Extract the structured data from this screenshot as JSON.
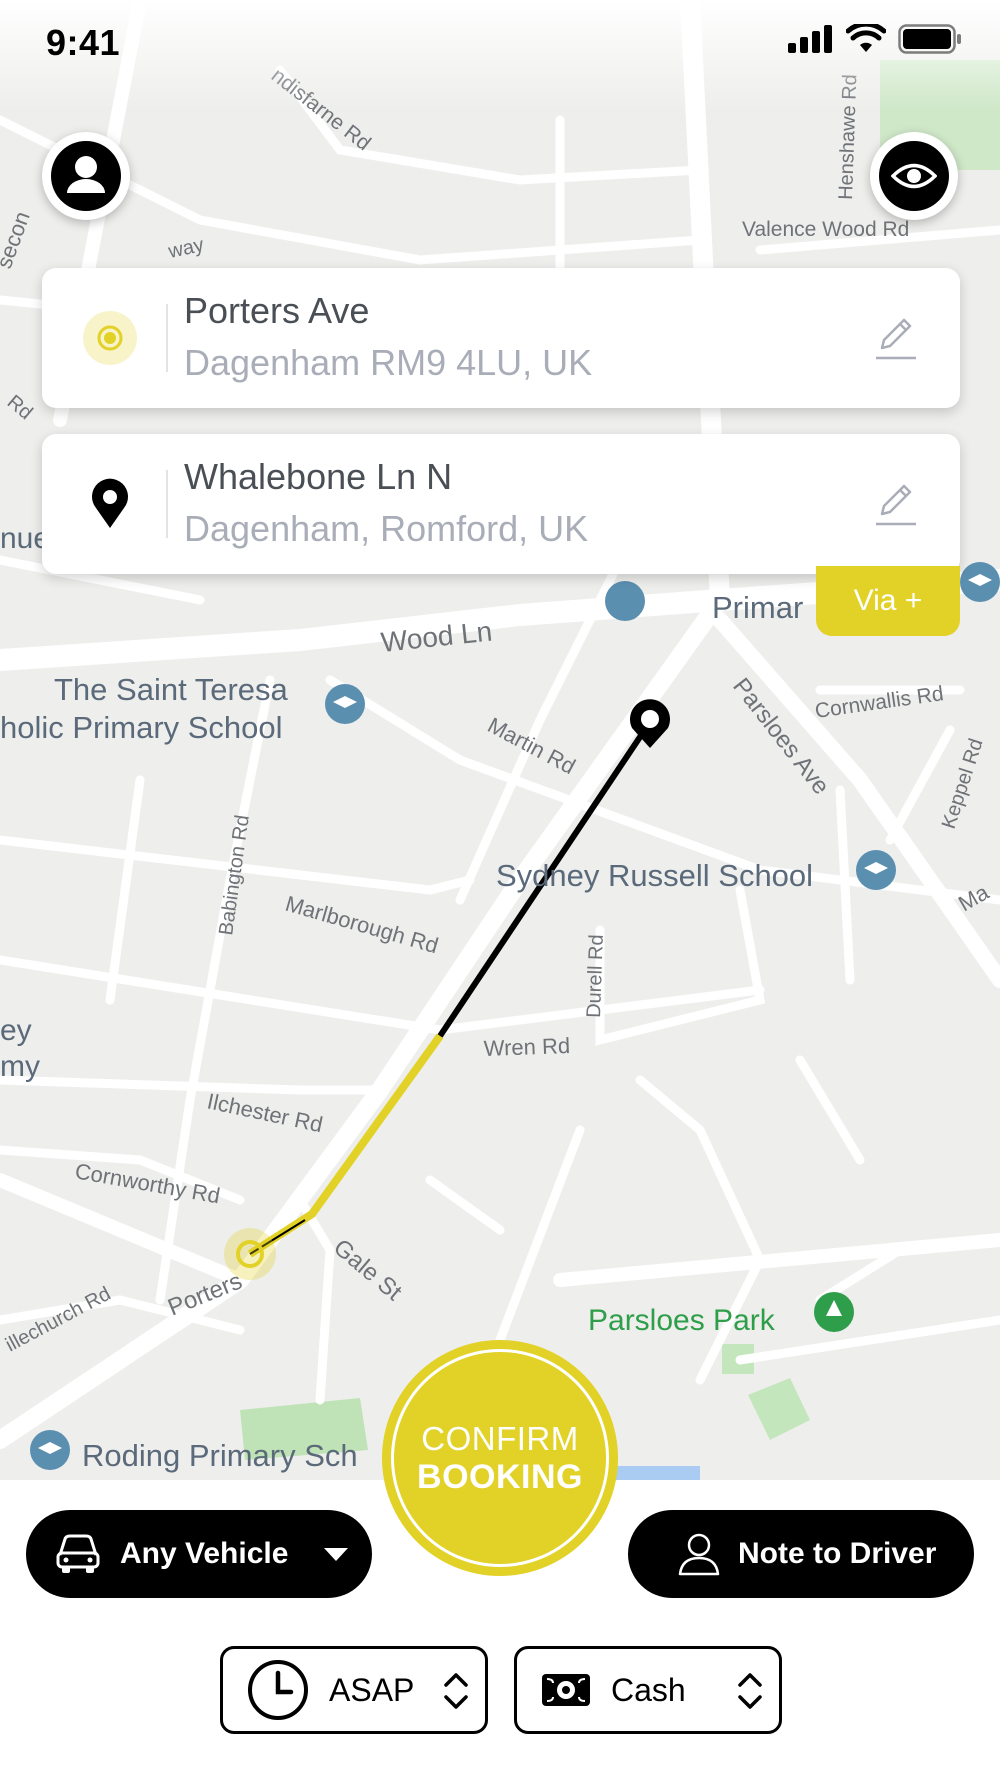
{
  "status_bar": {
    "time": "9:41"
  },
  "colors": {
    "accent": "#e2d126",
    "map_bg": "#eeeeec",
    "road": "#ffffff",
    "school_blue": "#5b8fb0",
    "park_green": "#2e9e4a"
  },
  "icons": {
    "profile": "person-circle-icon",
    "visibility": "eye-icon",
    "pickup": "target-dot-icon",
    "dropoff": "map-pin-icon",
    "edit": "pencil-icon",
    "vehicle": "car-icon",
    "driver_note": "person-outline-icon",
    "time": "clock-icon",
    "payment": "cash-icon"
  },
  "pickup": {
    "title": "Porters Ave",
    "subtitle": "Dagenham RM9 4LU, UK"
  },
  "dropoff": {
    "title": "Whalebone Ln N",
    "subtitle": "Dagenham, Romford, UK"
  },
  "via_label": "Via +",
  "map_labels": {
    "wood_ln": "Wood Ln",
    "saint_teresa_1": "The Saint Teresa",
    "saint_teresa_2": "holic Primary School",
    "martin_rd": "Martin Rd",
    "parsloes_ave": "Parsloes Ave",
    "cornwallis_rd": "Cornwallis Rd",
    "keppel_rd": "Keppel Rd",
    "sydney_russell": "Sydney Russell School",
    "babington_rd": "Babington Rd",
    "marlborough_rd": "Marlborough Rd",
    "durell_rd": "Durell Rd",
    "wren_rd": "Wren Rd",
    "ilchester_rd": "Ilchester Rd",
    "cornworthy_rd": "Cornworthy Rd",
    "gale_st": "Gale St",
    "porters": "Porters",
    "illechurch_rd": "illechurch Rd",
    "parsloes_park": "Parsloes Park",
    "roding_primary": "Roding Primary Sch",
    "valence_wood_rd": "Valence Wood Rd",
    "henshawe_rd": "Henshawe Rd",
    "lindisfarne_rd": "ndisfarne Rd",
    "primar": "Primar",
    "left_ey": "ey",
    "left_my": "my",
    "left_nue": "nue",
    "left_rd": "Rd",
    "left_way": "way",
    "left_secon": "secon",
    "right_ma": "Ma"
  },
  "confirm": {
    "line1": "CONFIRM",
    "line2": "BOOKING"
  },
  "vehicle_button": {
    "label": "Any Vehicle"
  },
  "note_button": {
    "label": "Note to Driver"
  },
  "time_select": {
    "value": "ASAP"
  },
  "payment_select": {
    "value": "Cash"
  }
}
